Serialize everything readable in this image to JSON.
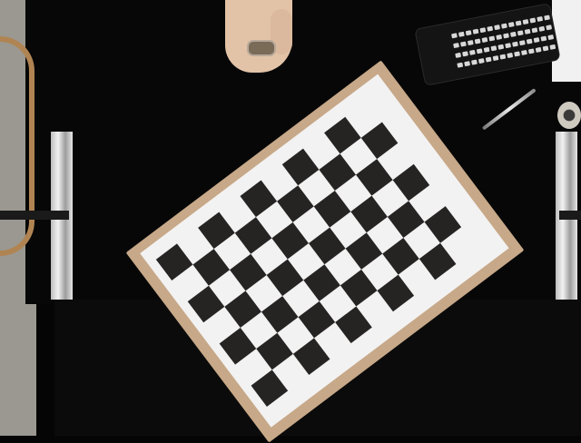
{
  "scene": {
    "description_items": [
      "checkerboard",
      "hand",
      "keyboard",
      "pen",
      "metal-rails",
      "chair"
    ]
  },
  "checkerboard": {
    "rows": 7,
    "cols": 10,
    "dark_color": "#262323",
    "light_color": "#f2f2f2",
    "backing_color": "#c7a888"
  },
  "keyboard": {
    "key_rows": 4,
    "key_cols": 14
  }
}
